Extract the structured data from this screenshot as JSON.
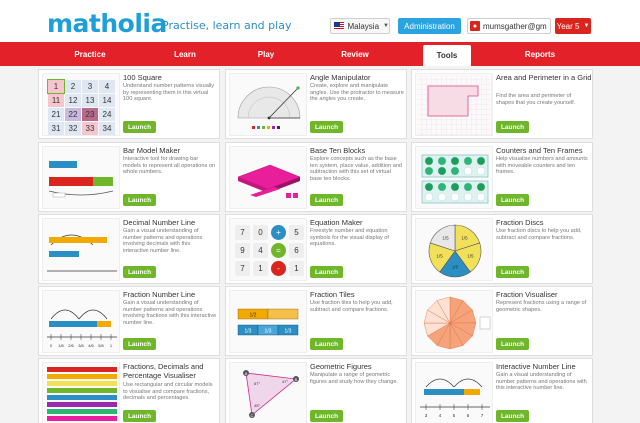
{
  "header": {
    "logo": "matholia",
    "tagline": "Practise, learn and play",
    "country": "Malaysia",
    "admin": "Administration",
    "user": "mumsgather@gm",
    "year": "Year 5"
  },
  "nav": {
    "items": [
      {
        "label": "Practice"
      },
      {
        "label": "Learn"
      },
      {
        "label": "Play"
      },
      {
        "label": "Review"
      },
      {
        "label": "Tools"
      },
      {
        "label": "Reports"
      }
    ]
  },
  "tools": [
    {
      "title": "100 Square",
      "desc": "Understand number patterns visually by representing them in this virtual 100 square.",
      "launch": "Launch"
    },
    {
      "title": "Angle Manipulator",
      "desc": "Create, explore and manipulate angles. Use the protractor to measure the angles you create.",
      "launch": "Launch"
    },
    {
      "title": "Area and Perimeter in a Grid",
      "desc": "Find the area and perimeter of shapes that you create yourself.",
      "launch": "Launch"
    },
    {
      "title": "Bar Model Maker",
      "desc": "Interactive tool for drawing bar models to represent all operations on whole numbers.",
      "launch": "Launch"
    },
    {
      "title": "Base Ten Blocks",
      "desc": "Explore concepts such as the base ten system, place value, addition and subtraction with this set of virtual base ten blocks.",
      "launch": "Launch"
    },
    {
      "title": "Counters and Ten Frames",
      "desc": "Help visualise numbers and amounts with moveable counters and ten frames.",
      "launch": "Launch"
    },
    {
      "title": "Decimal Number Line",
      "desc": "Gain a visual understanding of number patterns and operations involving decimals with this interactive number line.",
      "launch": "Launch"
    },
    {
      "title": "Equation Maker",
      "desc": "Freestyle number and equation symbols for the visual display of equations.",
      "launch": "Launch"
    },
    {
      "title": "Fraction Discs",
      "desc": "Use fraction discs to help you add, subtract and compare fractions.",
      "launch": "Launch"
    },
    {
      "title": "Fraction Number Line",
      "desc": "Gain a visual understanding of number patterns and operations involving fractions with this interactive number line.",
      "launch": "Launch"
    },
    {
      "title": "Fraction Tiles",
      "desc": "Use fraction tiles to help you add, subtract and compare fractions.",
      "launch": "Launch"
    },
    {
      "title": "Fraction Visualiser",
      "desc": "Represent fractions using a range of geometric shapes.",
      "launch": "Launch"
    },
    {
      "title": "Fractions, Decimals and Percentage Visualiser",
      "desc": "Use rectangular and circular models to visualise and compare fractions, decimals and percentages.",
      "launch": "Launch"
    },
    {
      "title": "Geometric Figures",
      "desc": "Manipulate a range of geometric figures and study how they change.",
      "launch": "Launch"
    },
    {
      "title": "Interactive Number Line",
      "desc": "Gain a visual understanding of number patterns and operations with this interactive number line.",
      "launch": "Launch"
    }
  ],
  "hundred_square": [
    "1",
    "2",
    "3",
    "4",
    "11",
    "12",
    "13",
    "14",
    "21",
    "22",
    "23",
    "24",
    "31",
    "32",
    "33",
    "34"
  ],
  "equation_tiles": [
    "7",
    "0",
    "+",
    "5",
    "9",
    "4",
    "=",
    "6",
    "7",
    "1",
    "-",
    "1"
  ],
  "fraction_disc_labels": [
    "1/5",
    "1/5",
    "1/5",
    "1/5",
    "1/5"
  ],
  "fraction_tiles_labels": [
    "1/2",
    "1/3",
    "1/3",
    "1/3"
  ],
  "geometric_labels": [
    "A",
    "B",
    "C",
    "67°",
    "47°",
    "45°"
  ],
  "number_line_ticks": [
    "0",
    "1/6",
    "2/6",
    "3/6",
    "4/6",
    "5/6",
    "1"
  ],
  "interactive_ticks": [
    "3",
    "4",
    "5",
    "6",
    "7"
  ],
  "colors": {
    "brand_blue": "#1f9fd9",
    "nav_red": "#e32129",
    "launch_green": "#6fb62b",
    "admin_blue": "#2ba3e0"
  },
  "icons": [
    "malaysia-flag-icon",
    "user-icon",
    "caret-down-icon"
  ]
}
